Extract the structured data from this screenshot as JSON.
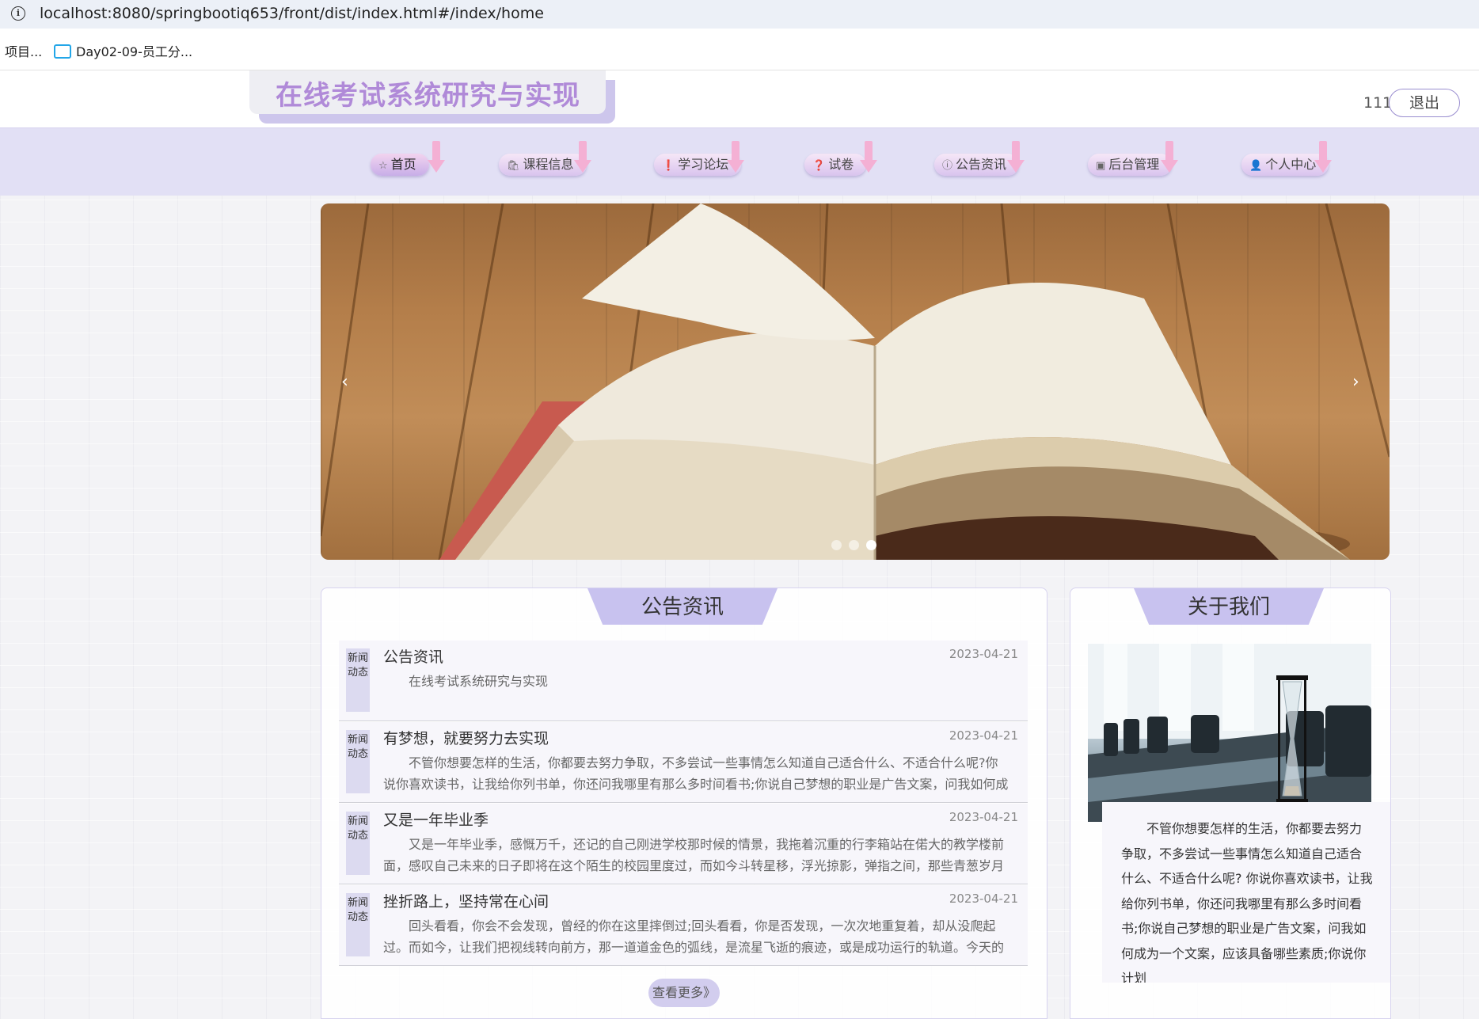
{
  "browser": {
    "url": "localhost:8080/springbootiq653/front/dist/index.html#/index/home",
    "bookmarks": [
      "项目...",
      "Day02-09-员工分..."
    ]
  },
  "header": {
    "site_title": "在线考试系统研究与实现",
    "user_name": "111",
    "logout_label": "退出"
  },
  "nav": {
    "items": [
      {
        "label": "首页",
        "icon": "star-icon"
      },
      {
        "label": "课程信息",
        "icon": "bag-icon"
      },
      {
        "label": "学习论坛",
        "icon": "alert-icon"
      },
      {
        "label": "试卷",
        "icon": "help-icon"
      },
      {
        "label": "公告资讯",
        "icon": "info-icon"
      },
      {
        "label": "后台管理",
        "icon": "admin-icon"
      },
      {
        "label": "个人中心",
        "icon": "user-icon"
      }
    ],
    "active_index": 0
  },
  "carousel": {
    "prev_label": "‹",
    "next_label": "›",
    "slide_count": 3,
    "active_slide": 3
  },
  "news": {
    "title": "公告资讯",
    "tag": "新闻动态",
    "items": [
      {
        "title": "公告资讯",
        "date": "2023-04-21",
        "desc": "在线考试系统研究与实现"
      },
      {
        "title": "有梦想，就要努力去实现",
        "date": "2023-04-21",
        "desc": "不管你想要怎样的生活，你都要去努力争取，不多尝试一些事情怎么知道自己适合什么、不适合什么呢?你说你喜欢读书，让我给你列书单，你还问我哪里有那么多时间看书;你说自己梦想的职业是广告文案，问我如何成为一"
      },
      {
        "title": "又是一年毕业季",
        "date": "2023-04-21",
        "desc": "又是一年毕业季，感慨万千，还记的自己刚进学校那时候的情景，我拖着沉重的行李箱站在偌大的教学楼前面，感叹自己未来的日子即将在这个陌生的校园里度过，而如今斗转星移，浮光掠影，弹指之间，那些青葱岁月如"
      },
      {
        "title": "挫折路上，坚持常在心间",
        "date": "2023-04-21",
        "desc": "回头看看，你会不会发现，曾经的你在这里摔倒过;回头看看，你是否发现，一次次地重复着，却从没爬起过。而如今，让我们把视线转向前方，那一道道金色的弧线，是流星飞逝的痕迹，或是成功运行的轨道。今天的你，是"
      }
    ],
    "more_label": "查看更多》"
  },
  "about": {
    "title": "关于我们",
    "text": "不管你想要怎样的生活，你都要去努力争取，不多尝试一些事情怎么知道自己适合什么、不适合什么呢? 你说你喜欢读书，让我给你列书单，你还问我哪里有那么多时间看书;你说自己梦想的职业是广告文案，问我如何成为一个文案，应该具备哪些素质;你说你计划"
  },
  "colors": {
    "accent": "#c8c2ef",
    "title_purple": "#b08ad8",
    "nav_bg": "#e2e0f5",
    "arrow_pink": "#f4b0d4"
  }
}
